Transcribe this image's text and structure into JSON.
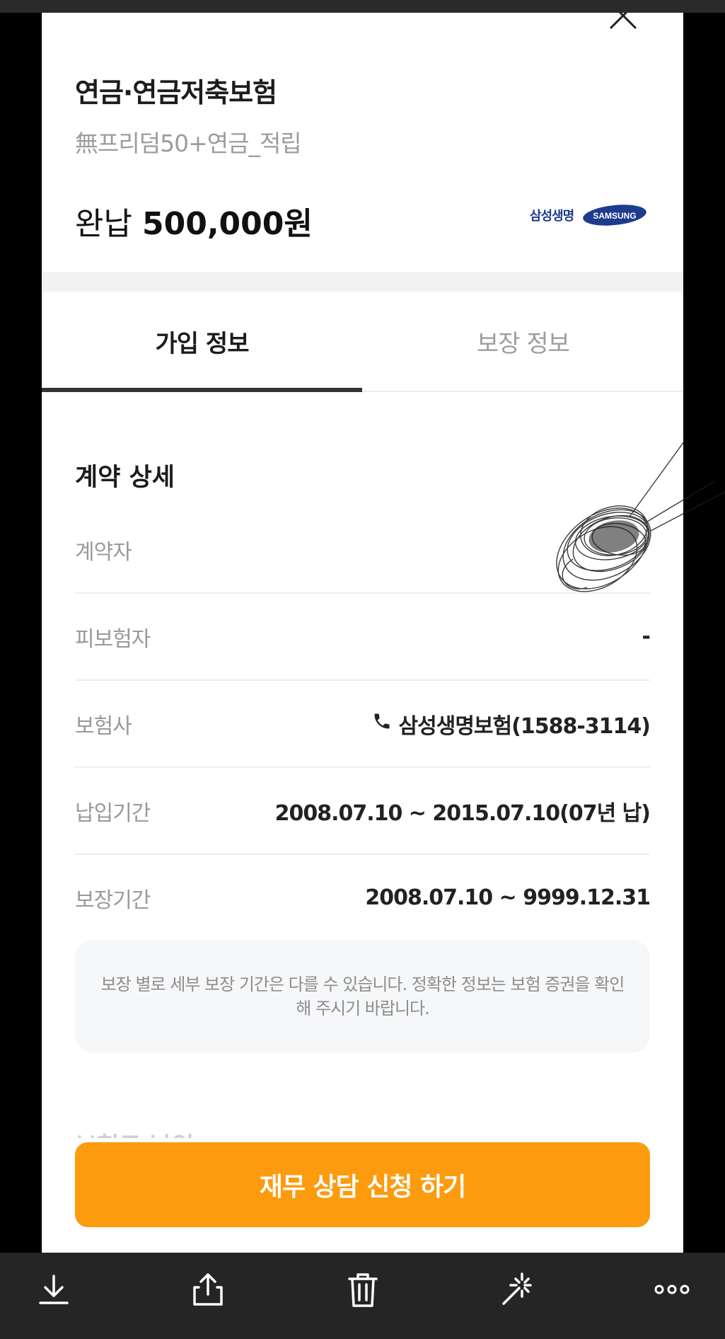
{
  "header": {
    "title": "연금·연금저축보험",
    "subtitle": "無프리덤50+연금_적립",
    "amount_prefix": "완납",
    "amount_value": "500,000원",
    "brand_text": "삼성생명",
    "brand_logo_text": "SAMSUNG",
    "brand_color": "#1d3c8e"
  },
  "tabs": [
    {
      "label": "가입 정보",
      "active": true
    },
    {
      "label": "보장 정보",
      "active": false
    }
  ],
  "section": {
    "title": "계약 상세",
    "rows": [
      {
        "label": "계약자",
        "value": ""
      },
      {
        "label": "피보험자",
        "value": "-"
      },
      {
        "label": "보험사",
        "value": "삼성생명보험(1588-3114)"
      },
      {
        "label": "납입기간",
        "value": "2008.07.10 ~ 2015.07.10(07년 납)"
      },
      {
        "label": "보장기간",
        "value": "2008.07.10 ~ 9999.12.31"
      }
    ]
  },
  "notice": "보장 별로 세부 보장 기간은 다를 수 있습니다. 정확한 정보는 보험 증권을 확인해 주시기 바랍니다.",
  "next_section_title": "보험료 납입",
  "cta": {
    "label": "재무 상담 신청 하기",
    "color": "#fd9b0f"
  },
  "toolbar": {
    "icons": [
      "download-icon",
      "share-icon",
      "trash-icon",
      "magic-wand-icon",
      "more-icon"
    ]
  }
}
